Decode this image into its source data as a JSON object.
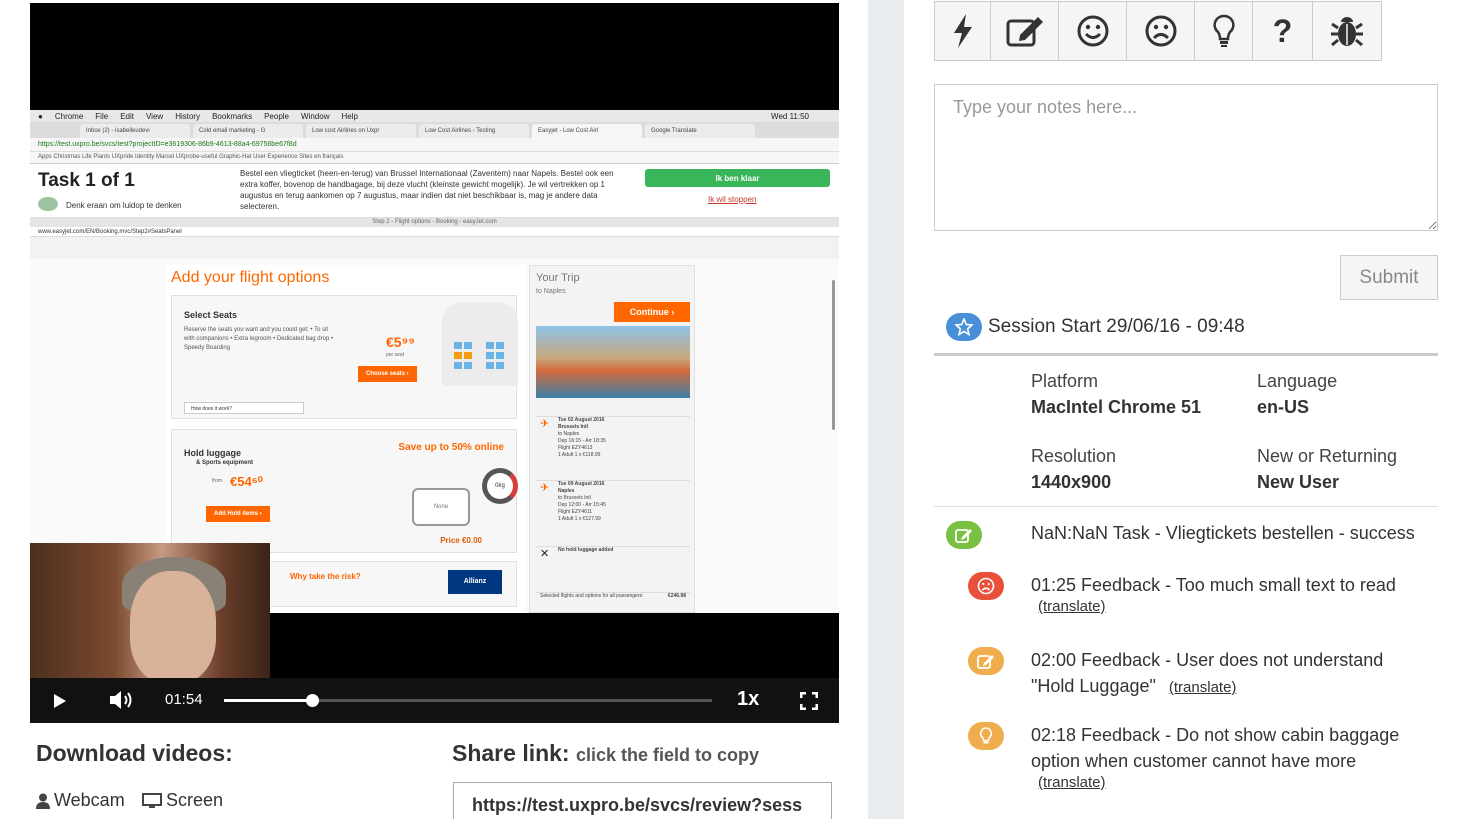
{
  "recording": {
    "mac_menu": [
      "Chrome",
      "File",
      "Edit",
      "View",
      "History",
      "Bookmarks",
      "People",
      "Window",
      "Help"
    ],
    "mac_clock": "Wed 11:50",
    "browser_tabs": [
      "Inbox (2) - isabelleudevi",
      "Cold email marketing - G",
      "Low cost Airlines on Uxpr",
      "Low Cost Airlines - Testing",
      "Easyjet - Low Cost Airl",
      "Google Translate"
    ],
    "address": "https://test.uxpro.be/svcs/test?projectID=e3619306-86b9-4613-88a4-69758be67f8d",
    "bookmarks": "Apps   Christmas   Life   Plants   UXpride Identity   Marcel   UXprobe-useful   Graphic-Hat   User Experience   Sites en français",
    "task_title": "Task 1 of 1",
    "task_hint": "Denk eraan om luidop te denken",
    "task_description": "Bestel een vliegticket (heen-en-terug) van Brussel Internationaal (Zaventem) naar Napels. Bestel ook een extra koffer, bovenop de handbagage, bij deze vlucht (kleinste gewicht mogelijk). Je wil vertrekken op 1 augustus en terug aankomen op 7 augustus, maar indien dat niet beschikbaar is, mag je andere data selecteren.",
    "task_done": "Ik ben klaar",
    "task_stop": "Ik wil stoppen",
    "inner_window_title": "Step 2 - Flight options - Booking - easyJet.com",
    "inner_address": "www.easyjet.com/EN/Booking.mvc/Step2#SeatsPanel",
    "site": {
      "heading": "Add your flight options",
      "seats_title": "Select Seats",
      "seats_text": "Reserve the seats you want and you could get: • To sit with companions • Extra legroom • Dedicated bag drop • Speedy Boarding",
      "seats_price": "€5⁹⁹",
      "seats_price_note": "per seat",
      "seats_button": "Choose seats ›",
      "seats_link": "How does it work?",
      "luggage_title": "Hold luggage",
      "luggage_sub": "& Sports equipment",
      "luggage_from": "from",
      "luggage_price": "€54⁶⁰",
      "luggage_button": "Add Hold items ›",
      "save_up": "Save up to 50% online",
      "none_label": "None",
      "gauge_label": "0kg",
      "price_zero": "Price €0.00",
      "insurance_text": "Why take the risk?",
      "insurance_logo": "Allianz",
      "trip_title": "Your Trip",
      "trip_sub": "to Naples",
      "continue": "Continue ›",
      "flights": [
        {
          "date": "Tue 02 August 2016",
          "from": "Brussels Intl",
          "to": "to Naples",
          "time": "Dep 16:15 - Arr 18:35",
          "flight": "Flight EZY4613",
          "price": "1 Adult   1 x €118.99"
        },
        {
          "date": "Tue 09 August 2016",
          "from": "Naples",
          "to": "to Brussels Intl",
          "time": "Dep 12:00 - Arr 15:45",
          "flight": "Flight EZY4611",
          "price": "1 Adult   1 x €127.99"
        }
      ],
      "no_luggage": "No hold luggage added",
      "total_label": "Selected flights and options for all passengers:",
      "total_value": "€246.98"
    }
  },
  "player": {
    "time": "01:54",
    "progress": 0.18,
    "speed": "1x"
  },
  "downloads": {
    "title": "Download videos:",
    "webcam": "Webcam",
    "screen": "Screen"
  },
  "share": {
    "title": "Share link:",
    "hint": "click the field to copy",
    "value": "https://test.uxpro.be/svcs/review?sess"
  },
  "notes": {
    "placeholder": "Type your notes here...",
    "submit": "Submit"
  },
  "toolbar": {
    "icons": [
      "lightning-icon",
      "edit-icon",
      "smile-icon",
      "frown-icon",
      "lightbulb-icon",
      "question-icon",
      "bug-icon"
    ]
  },
  "session": {
    "title": "Session Start 29/06/16 - 09:48",
    "platform_label": "Platform",
    "platform": "MacIntel Chrome 51",
    "language_label": "Language",
    "language": "en-US",
    "resolution_label": "Resolution",
    "resolution": "1440x900",
    "visitor_label": "New or Returning",
    "visitor": "New User"
  },
  "events": [
    {
      "text": "NaN:NaN Task - Vliegtickets bestellen - success",
      "icon": "edit-icon",
      "color": "#7ac143"
    },
    {
      "text": "01:25 Feedback - Too much small text to read",
      "translate": "(translate)",
      "icon": "frown-icon",
      "color": "#e8503a"
    },
    {
      "text_line1": "02:00 Feedback - User does not understand",
      "text_line2": "\"Hold Luggage\"",
      "translate": "(translate)",
      "icon": "edit-icon",
      "color": "#f0ad4e"
    },
    {
      "text": "02:18 Feedback - Do not show cabin baggage option when customer cannot have more",
      "translate": "(translate)",
      "icon": "lightbulb-icon",
      "color": "#f0ad4e"
    }
  ],
  "colors": {
    "accent_blue": "#4a90d9",
    "easyjet_orange": "#ff6600",
    "success_green": "#7ac143",
    "danger_red": "#e8503a",
    "warning_orange": "#f0ad4e"
  }
}
